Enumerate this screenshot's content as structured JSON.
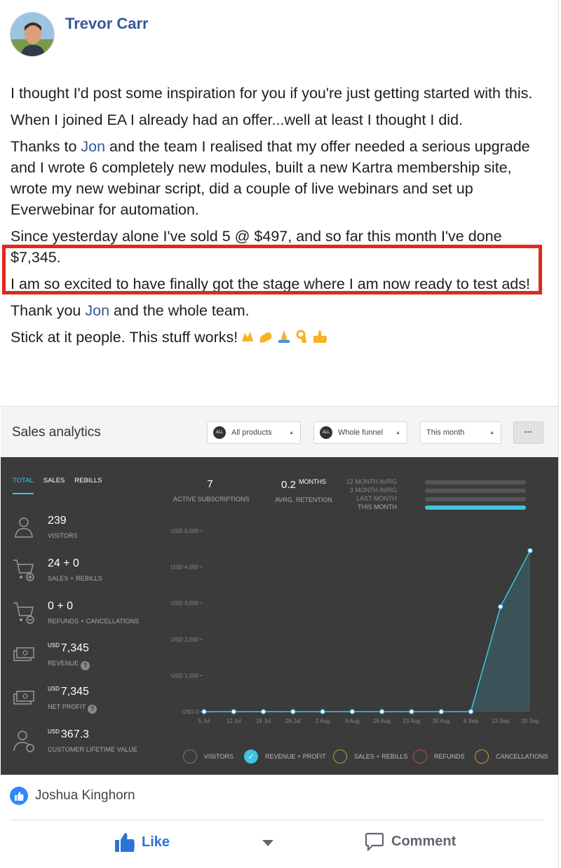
{
  "author": {
    "name": "Trevor Carr"
  },
  "post": {
    "p1": "I thought I'd post some inspiration for you if you're just getting started with this.",
    "p2": "When I joined EA I already had an offer...well at least I thought I did.",
    "p3_pre": "Thanks to ",
    "p3_mention": "Jon",
    "p3_post": " and the team I realised that my offer needed a serious upgrade and I wrote 6 completely new modules, built a new Kartra membership site, wrote my new webinar script, did a couple of live webinars and set up Everwebinar for automation.",
    "p4": "Since yesterday alone I've sold 5 @ $497, and so far this month I've done $7,345.",
    "p5": "I am so excited to have finally got the stage where I am now ready to test ads!",
    "p6_pre": "Thank you ",
    "p6_mention": "Jon",
    "p6_post": " and the whole team.",
    "p7": "Stick at it people. This stuff works!",
    "emojis": [
      "raised-hands",
      "flexed-biceps",
      "folded-hands",
      "ok-hand",
      "thumbs-up"
    ]
  },
  "analytics": {
    "title": "Sales analytics",
    "filters": [
      {
        "badge": "ALL",
        "label": "All products"
      },
      {
        "badge": "ALL",
        "label": "Whole funnel"
      },
      {
        "badge": "",
        "label": "This month"
      }
    ],
    "more_label": "···",
    "tabs": [
      "TOTAL",
      "SALES",
      "REBILLS"
    ],
    "metrics": [
      {
        "icon": "visitor-icon",
        "value": "239",
        "currency": "",
        "label": "VISITORS",
        "help": ""
      },
      {
        "icon": "cart-add-icon",
        "value": "24 + 0",
        "currency": "",
        "label": "SALES + REBILLS",
        "help": ""
      },
      {
        "icon": "cart-remove-icon",
        "value": "0 + 0",
        "currency": "",
        "label": "REFUNDS + CANCELLATIONS",
        "help": ""
      },
      {
        "icon": "money-icon",
        "value": "7,345",
        "currency": "USD",
        "label": "REVENUE",
        "help": "?"
      },
      {
        "icon": "money-icon",
        "value": "7,345",
        "currency": "USD",
        "label": "NET PROFIT",
        "help": "?"
      },
      {
        "icon": "customer-value-icon",
        "value": "367.3",
        "currency": "USD",
        "label": "CUSTOMER LIFETIME VALUE",
        "help": ""
      }
    ],
    "stats": [
      {
        "value": "7",
        "unit": "",
        "label": "ACTIVE SUBSCRIPTIONS"
      },
      {
        "value": "0.2",
        "unit": "MONTHS",
        "label": "AVRG. RETENTION"
      }
    ],
    "compare": [
      {
        "label": "12 MONTH AVRG",
        "active": false
      },
      {
        "label": "3 MONTH AVRG",
        "active": false
      },
      {
        "label": "LAST MONTH",
        "active": false
      },
      {
        "label": "THIS MONTH",
        "active": true
      }
    ],
    "legend": [
      {
        "label": "VISITORS",
        "color": "#777777",
        "checked": false
      },
      {
        "label": "REVENUE + PROFIT",
        "color": "#3fc3e0",
        "checked": true
      },
      {
        "label": "SALES + REBILLS",
        "color": "#a3a332",
        "checked": false
      },
      {
        "label": "REFUNDS",
        "color": "#b0503c",
        "checked": false
      },
      {
        "label": "CANCELLATIONS",
        "color": "#c89a2a",
        "checked": false
      }
    ]
  },
  "chart_data": {
    "type": "area",
    "x": [
      "5 Jul",
      "12 Jul",
      "19 Jul",
      "26 Jul",
      "2 Aug",
      "9 Aug",
      "16 Aug",
      "23 Aug",
      "30 Aug",
      "6 Sep",
      "13 Sep",
      "20 Sep"
    ],
    "series": [
      {
        "name": "REVENUE + PROFIT",
        "values": [
          0,
          0,
          0,
          0,
          0,
          0,
          0,
          0,
          0,
          0,
          2900,
          4450
        ]
      }
    ],
    "yticks": [
      "USD 0",
      "USD 1,000",
      "USD 2,000",
      "USD 3,000",
      "USD 4,000",
      "USD 5,000"
    ],
    "ylim": [
      0,
      5000
    ],
    "line_color": "#3fc3e0"
  },
  "reactions": {
    "reactor": "Joshua Kinghorn"
  },
  "actions": {
    "like": "Like",
    "comment": "Comment"
  }
}
